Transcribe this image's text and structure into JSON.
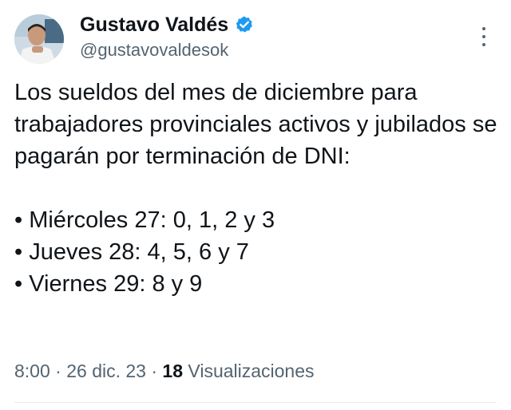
{
  "author": {
    "name": "Gustavo Valdés",
    "handle": "@gustavovaldesok",
    "verified_color": "#1d9bf0"
  },
  "tweet": {
    "intro": "Los sueldos del mes de diciembre para trabajadores provinciales activos y jubilados se pagarán por terminación de DNI:",
    "schedule": [
      "• Miércoles 27: 0, 1, 2 y 3",
      "• Jueves 28: 4, 5, 6 y 7",
      "• Viernes 29: 8 y 9"
    ]
  },
  "meta": {
    "time": "8:00",
    "separator": " · ",
    "date": "26 dic. 23",
    "views_count": "18",
    "views_label": "Visualizaciones"
  },
  "icons": {
    "verified": "verified-badge-icon",
    "more": "more-options-icon"
  }
}
